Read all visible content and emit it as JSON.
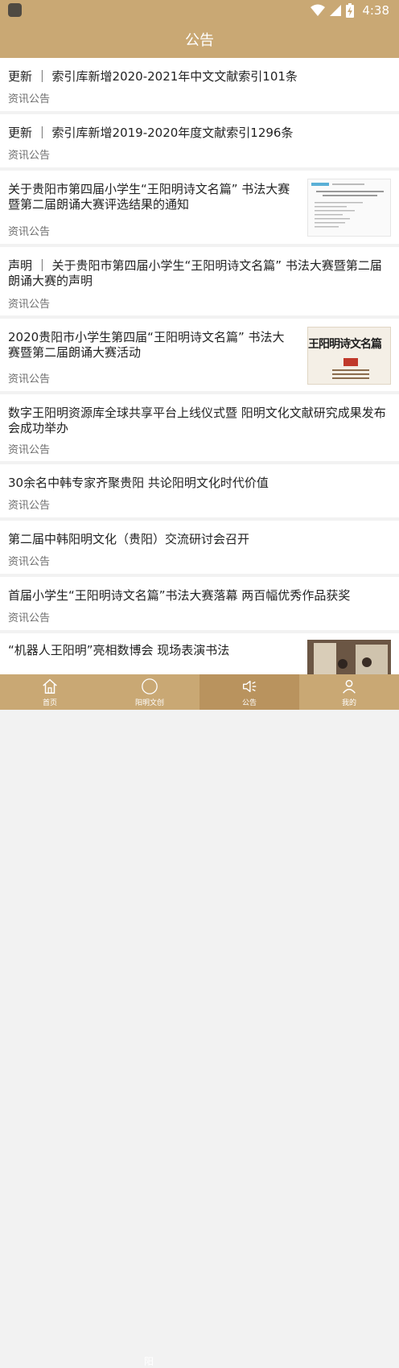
{
  "status": {
    "time": "4:38"
  },
  "header": {
    "title": "公告"
  },
  "items": [
    {
      "title": "更新 ｜ 索引库新增2020-2021年中文文献索引101条",
      "category": "资讯公告"
    },
    {
      "title": "更新 ｜ 索引库新增2019-2020年度文献索引1296条",
      "category": "资讯公告"
    },
    {
      "title": "关于贵阳市第四届小学生“王阳明诗文名篇” 书法大赛暨第二届朗诵大赛评选结果的通知",
      "category": "资讯公告"
    },
    {
      "title": "声明 ｜ 关于贵阳市第四届小学生“王阳明诗文名篇” 书法大赛暨第二届朗诵大赛的声明",
      "category": "资讯公告"
    },
    {
      "title": "2020贵阳市小学生第四届“王阳明诗文名篇” 书法大赛暨第二届朗诵大赛活动",
      "category": "资讯公告",
      "thumb_text": "王阳明诗文名篇"
    },
    {
      "title": "数字王阳明资源库全球共享平台上线仪式暨  阳明文化文献研究成果发布会成功举办",
      "category": "资讯公告"
    },
    {
      "title": "30余名中韩专家齐聚贵阳  共论阳明文化时代价值",
      "category": "资讯公告"
    },
    {
      "title": "第二届中韩阳明文化（贵阳）交流研讨会召开",
      "category": "资讯公告"
    },
    {
      "title": "首届小学生“王阳明诗文名篇”书法大赛落幕  两百幅优秀作品获奖",
      "category": "资讯公告"
    },
    {
      "title": "“机器人王阳明”亮相数博会  现场表演书法",
      "category": ""
    }
  ],
  "tabs": [
    {
      "label": "首页",
      "icon": "home-icon"
    },
    {
      "label": "阳明文创",
      "icon": "yang-circle-icon",
      "glyph": "阳"
    },
    {
      "label": "公告",
      "icon": "speaker-icon"
    },
    {
      "label": "我的",
      "icon": "person-icon"
    }
  ],
  "colors": {
    "brand": "#c9a874",
    "active_tab": "#b9935e"
  }
}
